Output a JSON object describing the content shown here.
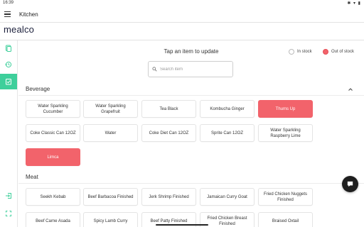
{
  "statusbar": {
    "time": "16:39",
    "icons": "✱ ▾ ▮"
  },
  "appbar": {
    "title": "Kitchen",
    "menu_icon": "hamburger-menu-icon"
  },
  "brand": {
    "logo_text": "mealco"
  },
  "sidebar": {
    "items": [
      {
        "name": "menu-icon",
        "active": false
      },
      {
        "name": "history-icon",
        "active": false
      },
      {
        "name": "stock-check-icon",
        "active": true
      },
      {
        "name": "logout-icon",
        "active": false
      },
      {
        "name": "fullscreen-icon",
        "active": false
      }
    ]
  },
  "main": {
    "prompt": "Tap an item to update",
    "legend": {
      "in_stock": "In stock",
      "out_of_stock": "Out of stock"
    },
    "search": {
      "placeholder": "Search item",
      "value": ""
    }
  },
  "sections": [
    {
      "title": "Beverage",
      "expanded": true,
      "items": [
        {
          "label": "Water Sparkling Cucumber",
          "out": false
        },
        {
          "label": "Water Sparkling Grapefruit",
          "out": false
        },
        {
          "label": "Tea Black",
          "out": false
        },
        {
          "label": "Kombucha Ginger",
          "out": false
        },
        {
          "label": "Thums Up",
          "out": true
        },
        {
          "label": "Coke Classic Can 12OZ",
          "out": false
        },
        {
          "label": "Water",
          "out": false
        },
        {
          "label": "Coke Diet Can 12OZ",
          "out": false
        },
        {
          "label": "Sprite Can 12OZ",
          "out": false
        },
        {
          "label": "Water Sparkling Raspberry Lime",
          "out": false
        },
        {
          "label": "Limca",
          "out": true
        }
      ]
    },
    {
      "title": "Meat",
      "expanded": true,
      "items": [
        {
          "label": "Seekh Kebab",
          "out": false
        },
        {
          "label": "Beef Barbacoa Finished",
          "out": false
        },
        {
          "label": "Jerk Shrimp Finished",
          "out": false
        },
        {
          "label": "Jamaican Curry Goat",
          "out": false
        },
        {
          "label": "Fried Chicken Nuggets Finished",
          "out": false
        },
        {
          "label": "Beef Carne Asada",
          "out": false
        },
        {
          "label": "Spicy Lamb Curry",
          "out": false
        },
        {
          "label": "Beef Patty Finished",
          "out": false
        },
        {
          "label": "Fried Chicken Breast Finished",
          "out": false
        },
        {
          "label": "Braised Oxtail",
          "out": false
        }
      ]
    }
  ],
  "colors": {
    "accent": "#3ecf9b",
    "out_of_stock": "#f2636b",
    "brand_text": "#1b1f3b"
  },
  "fab": {
    "icon": "chat-icon"
  }
}
